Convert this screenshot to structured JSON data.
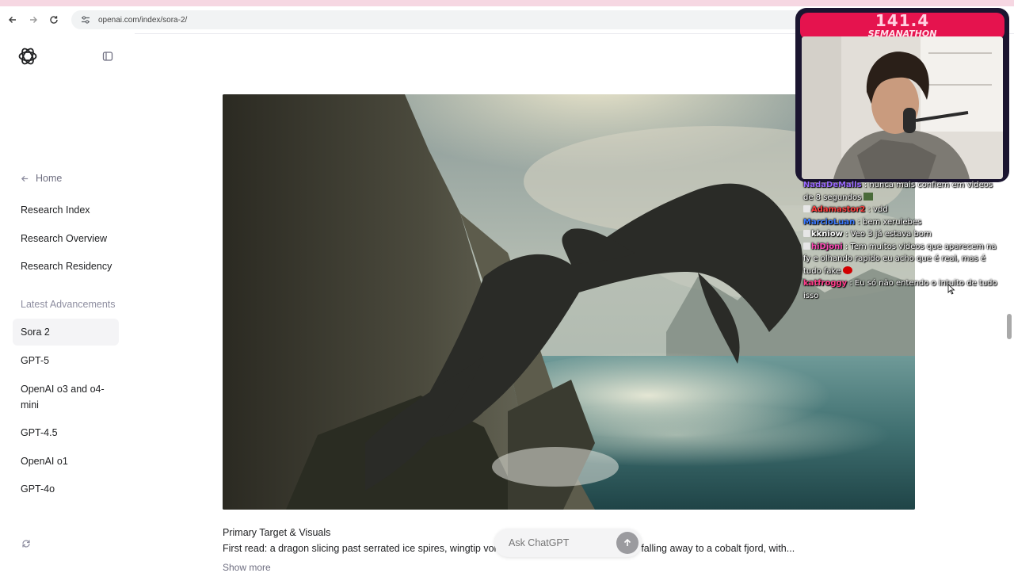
{
  "browser": {
    "url": "openai.com/index/sora-2/"
  },
  "sidebar": {
    "home_label": "Home",
    "research_items": [
      {
        "label": "Research Index"
      },
      {
        "label": "Research Overview"
      },
      {
        "label": "Research Residency"
      }
    ],
    "section_label": "Latest Advancements",
    "advancement_items": [
      {
        "label": "Sora 2",
        "active": true
      },
      {
        "label": "GPT-5"
      },
      {
        "label": "OpenAI o3 and o4-mini"
      },
      {
        "label": "GPT-4.5"
      },
      {
        "label": "OpenAI o1"
      },
      {
        "label": "GPT-4o"
      }
    ]
  },
  "main": {
    "caption_title": "Primary Target & Visuals",
    "caption_text": "First read: a dragon slicing past serrated ice spires, wingtip vortic… ne glacier's fractured sheet falling away to a cobalt fjord, with...",
    "show_more": "Show more"
  },
  "ask": {
    "placeholder": "Ask ChatGPT"
  },
  "overlay": {
    "counter": "141.4",
    "event": "SEMANATHON",
    "chat": [
      {
        "user": "NadaDeMalls",
        "user_color": "#9b6bff",
        "text": ": nunca mais confiem em videos de 8 segundos",
        "emote": "box"
      },
      {
        "user": "Adamastor2",
        "user_color": "#ff4040",
        "badge": true,
        "text": ": vdd"
      },
      {
        "user": "MarcioLuan",
        "user_color": "#3c7bff",
        "text": ": bem xerulebes"
      },
      {
        "user": "kkniow",
        "user_color": "#ffffff",
        "badge": true,
        "text": ": Veo 3 já estava bom"
      },
      {
        "user": "hiDjoni",
        "user_color": "#ff4db8",
        "badge": true,
        "text": ": Tem muitos videos que aparecem na fy e olhando rapido eu acho que é real, mas é tudo fake",
        "emote": "red"
      },
      {
        "user": "katfroggy",
        "user_color": "#ff3c8a",
        "text": ": Eu só não entendo o intuito de tudo isso"
      }
    ]
  },
  "colors": {
    "accent_pink": "#e5134e",
    "active_bg": "#f4f4f6"
  }
}
